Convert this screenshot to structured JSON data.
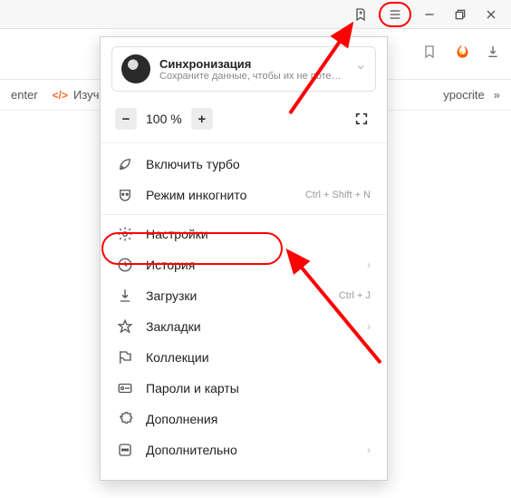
{
  "titlebar": {
    "bookmark_tab_tip": "Добавить на панель закладок",
    "menu_tip": "Меню",
    "minimize_tip": "Свернуть",
    "maximize_tip": "Развернуть",
    "close_tip": "Закрыть"
  },
  "bookmarks_bar": {
    "item_left_partial": "enter",
    "item_izuchen": "Изучен",
    "item_hypocrite": "ypocrite"
  },
  "sync": {
    "title": "Синхронизация",
    "subtitle": "Сохраните данные, чтобы их не потерять"
  },
  "zoom": {
    "minus": "−",
    "value": "100 %",
    "plus": "+"
  },
  "menu": {
    "turbo": "Включить турбо",
    "incognito": "Режим инкогнито",
    "incognito_shortcut": "Ctrl + Shift + N",
    "settings": "Настройки",
    "history": "История",
    "downloads": "Загрузки",
    "downloads_shortcut": "Ctrl + J",
    "bookmarks": "Закладки",
    "collections": "Коллекции",
    "passwords": "Пароли и карты",
    "addons": "Дополнения",
    "more": "Дополнительно"
  }
}
